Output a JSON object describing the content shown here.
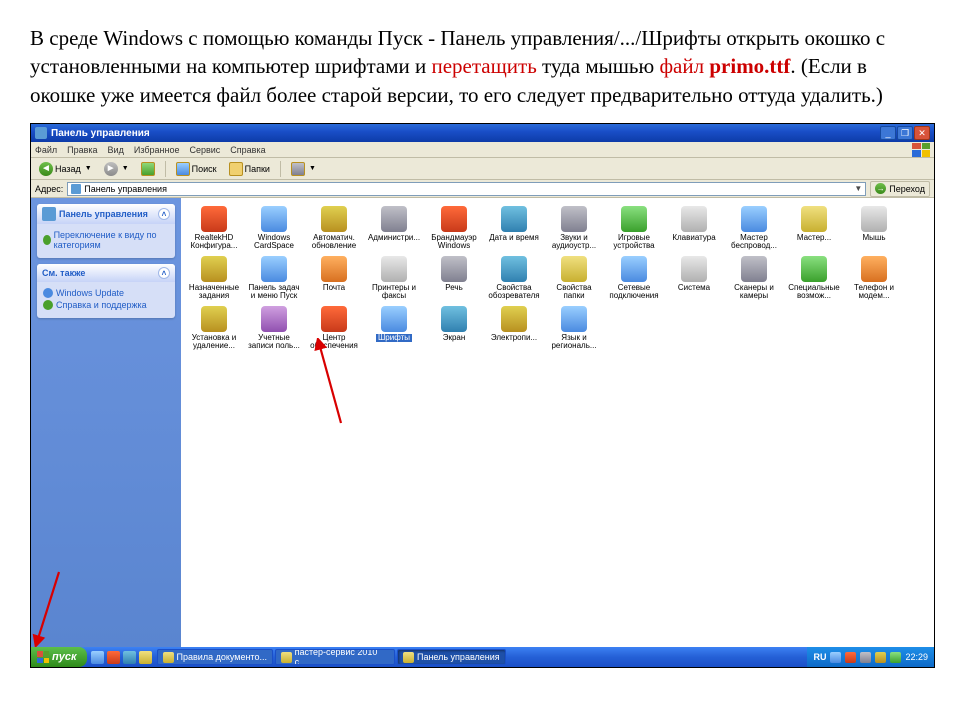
{
  "instruction": {
    "t1": "В среде Windows с помощью команды Пуск - Панель управления/.../Шрифты открыть окошко с установленными на компьютер шрифтами и ",
    "t2_red": "перетащить",
    "t3": " туда мышью ",
    "t4_red": "файл ",
    "t5_red_bold": "primo.ttf",
    "t6": ". (Если в окошке уже имеется файл более старой версии, то его следует предварительно оттуда удалить.)"
  },
  "window": {
    "title": "Панель управления",
    "menus": [
      "Файл",
      "Правка",
      "Вид",
      "Избранное",
      "Сервис",
      "Справка"
    ],
    "toolbar": {
      "back": "Назад",
      "search": "Поиск",
      "folders": "Папки"
    },
    "address_label": "Адрес:",
    "address_value": "Панель управления",
    "go": "Переход"
  },
  "sidebar": {
    "panel1": {
      "title": "Панель управления",
      "link": "Переключение к виду по категориям"
    },
    "panel2": {
      "title": "См. также",
      "links": [
        "Windows Update",
        "Справка и поддержка"
      ]
    }
  },
  "items": [
    {
      "label": "RealtekHD Конфигура...",
      "c": "c1"
    },
    {
      "label": "Windows CardSpace",
      "c": "c2"
    },
    {
      "label": "Автоматич. обновление",
      "c": "c3"
    },
    {
      "label": "Администри...",
      "c": "c6"
    },
    {
      "label": "Брандмауэр Windows",
      "c": "c1"
    },
    {
      "label": "Дата и время",
      "c": "c8"
    },
    {
      "label": "Звуки и аудиоустр...",
      "c": "c6"
    },
    {
      "label": "Игровые устройства",
      "c": "c4"
    },
    {
      "label": "Клавиатура",
      "c": "c10"
    },
    {
      "label": "Мастер беспровод...",
      "c": "c2"
    },
    {
      "label": "Мастер...",
      "c": "c9"
    },
    {
      "label": "Мышь",
      "c": "c10"
    },
    {
      "label": "Назначенные задания",
      "c": "c3"
    },
    {
      "label": "Панель задач и меню Пуск",
      "c": "c2"
    },
    {
      "label": "Почта",
      "c": "c7"
    },
    {
      "label": "Принтеры и факсы",
      "c": "c10"
    },
    {
      "label": "Речь",
      "c": "c6"
    },
    {
      "label": "Свойства обозревателя",
      "c": "c8"
    },
    {
      "label": "Свойства папки",
      "c": "c9"
    },
    {
      "label": "Сетевые подключения",
      "c": "c2"
    },
    {
      "label": "Система",
      "c": "c10"
    },
    {
      "label": "Сканеры и камеры",
      "c": "c6"
    },
    {
      "label": "Специальные возмож...",
      "c": "c4"
    },
    {
      "label": "Телефон и модем...",
      "c": "c7"
    },
    {
      "label": "Установка и удаление...",
      "c": "c3"
    },
    {
      "label": "Учетные записи поль...",
      "c": "c5"
    },
    {
      "label": "Центр обеспечения б...",
      "c": "c1"
    },
    {
      "label": "Шрифты",
      "c": "c2",
      "selected": true
    },
    {
      "label": "Экран",
      "c": "c8"
    },
    {
      "label": "Электропи...",
      "c": "c3"
    },
    {
      "label": "Язык и региональ...",
      "c": "c2"
    }
  ],
  "taskbar": {
    "start": "пуск",
    "tasks": [
      {
        "label": "Правила документо..."
      },
      {
        "label": "пастер-сервис 2010 с..."
      },
      {
        "label": "Панель управления",
        "pressed": true
      }
    ],
    "tray": {
      "lang": "RU",
      "time": "22:29"
    }
  }
}
